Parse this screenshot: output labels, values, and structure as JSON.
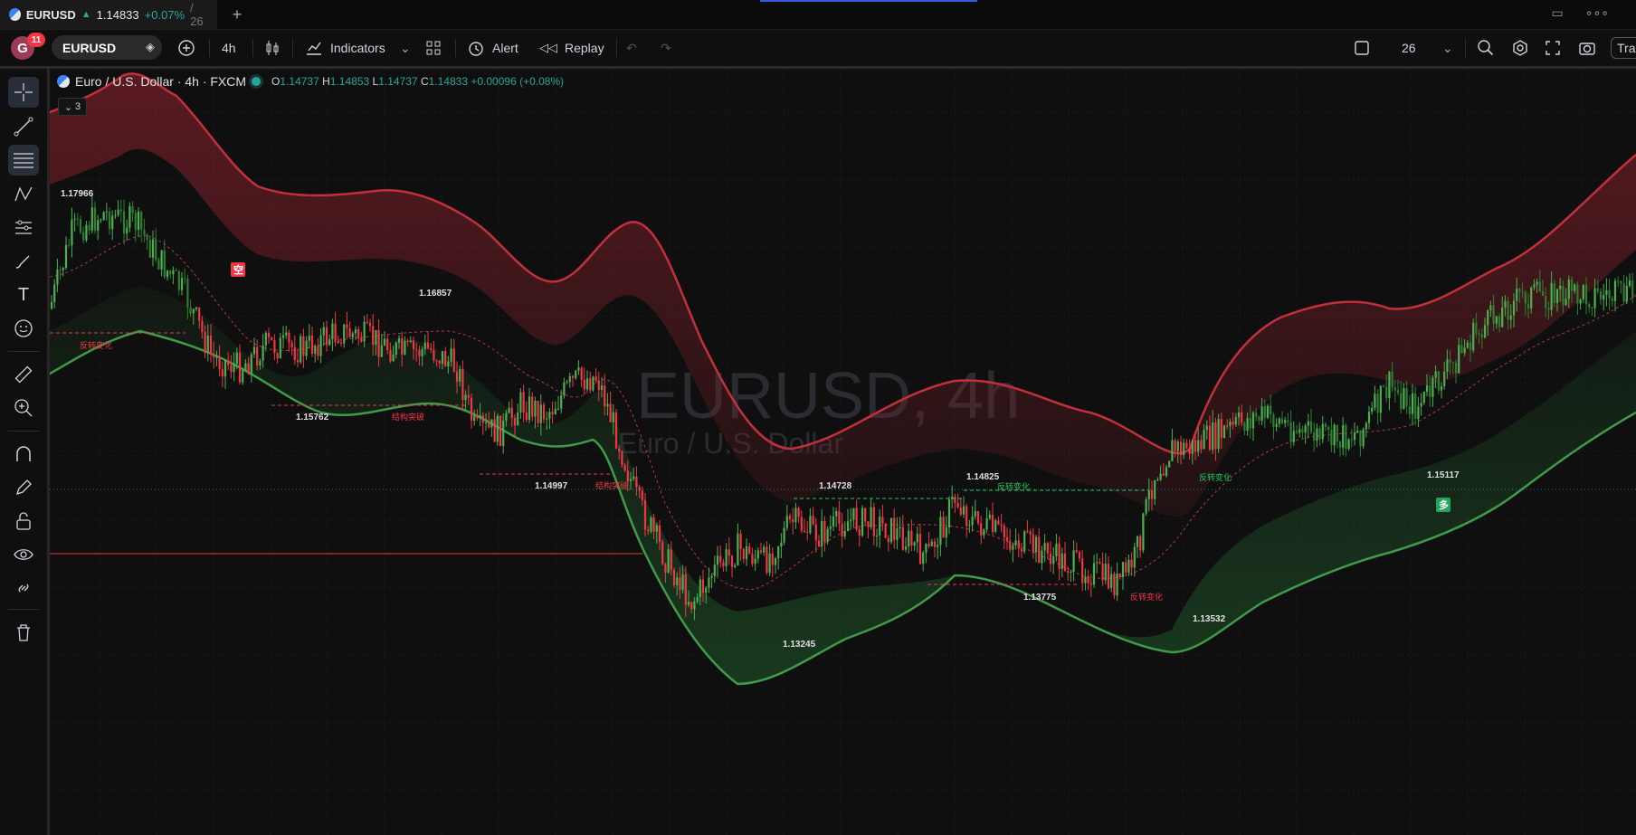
{
  "tab": {
    "symbol": "EURUSD",
    "price": "1.14833",
    "change": "+0.07%",
    "count": "/ 26"
  },
  "toolbar": {
    "avatar_letter": "G",
    "notifications": "11",
    "symbol": "EURUSD",
    "interval": "4h",
    "indicators_label": "Indicators",
    "alert_label": "Alert",
    "replay_label": "Replay",
    "layout_count": "26",
    "trade_label": "Tra"
  },
  "legend": {
    "title": "Euro / U.S. Dollar · 4h · FXCM",
    "o_label": "O",
    "o": "1.14737",
    "h_label": "H",
    "h": "1.14853",
    "l_label": "L",
    "l": "1.14737",
    "c_label": "C",
    "c": "1.14833",
    "change": "+0.00096 (+0.08%)",
    "collapsed_count": "3"
  },
  "watermark": {
    "main": "EURUSD, 4h",
    "sub": "Euro / U.S. Dollar"
  },
  "chart_data": {
    "type": "candlestick",
    "symbol": "EURUSD",
    "interval": "4h",
    "current_price": 1.14833,
    "swing_labels": [
      {
        "text": "1.17966",
        "value": 1.17966
      },
      {
        "text": "1.16857",
        "value": 1.16857
      },
      {
        "text": "1.15762",
        "value": 1.15762
      },
      {
        "text": "1.14997",
        "value": 1.14997
      },
      {
        "text": "1.14728",
        "value": 1.14728
      },
      {
        "text": "1.14825",
        "value": 1.14825
      },
      {
        "text": "1.13775",
        "value": 1.13775
      },
      {
        "text": "1.13532",
        "value": 1.13532
      },
      {
        "text": "1.13245",
        "value": 1.13245
      },
      {
        "text": "1.15117",
        "value": 1.15117
      }
    ],
    "annotations": [
      {
        "text": "反转变化",
        "color": "#f23645"
      },
      {
        "text": "结构突破",
        "color": "#f23645"
      },
      {
        "text": "结构突破",
        "color": "#f23645"
      },
      {
        "text": "反转变化",
        "color": "#22c55e"
      },
      {
        "text": "反转变化",
        "color": "#22c55e"
      },
      {
        "text": "反转变化",
        "color": "#f23645"
      }
    ],
    "signals": [
      {
        "text": "空",
        "color": "#f23645"
      },
      {
        "text": "多",
        "color": "#22a55a"
      }
    ],
    "colors": {
      "bull": "#4caf50",
      "bear": "#f23645",
      "upper_band": "#c2303c",
      "lower_band": "#3f9b4a",
      "background": "#0f0f0f"
    }
  }
}
